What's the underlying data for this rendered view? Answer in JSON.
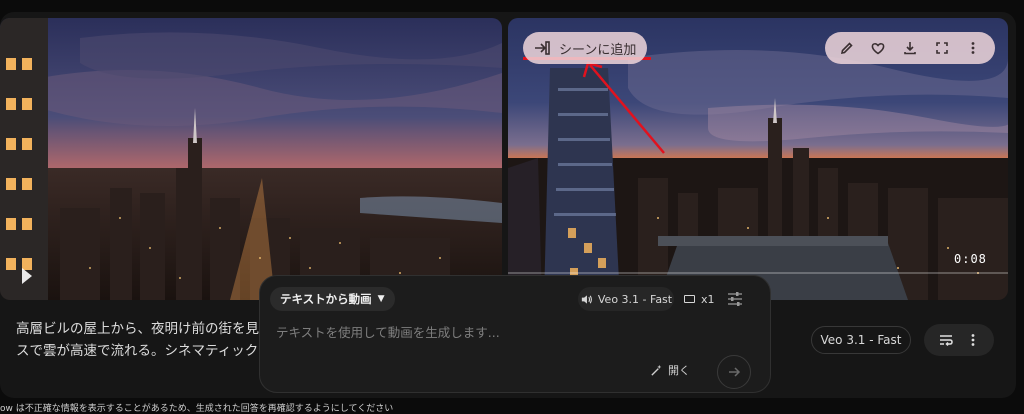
{
  "overlay": {
    "add_scene_label": "シーンに追加",
    "timestamp": "0:08"
  },
  "toolbar": {
    "icons": [
      "pencil-icon",
      "heart-icon",
      "download-icon",
      "fullscreen-icon",
      "more-vert-icon"
    ]
  },
  "description": {
    "line1": "高層ビルの屋上から、夜明け前の街を見下",
    "line2": "スで雲が高速で流れる。シネマティック"
  },
  "side_actions": {
    "model_label": "Veo 3.1 - Fast"
  },
  "composer": {
    "mode_label": "テキストから動画",
    "model_label": "Veo 3.1 - Fast",
    "count_label": "x1",
    "placeholder": "テキストを使用して動画を生成します...",
    "open_label": "開く"
  },
  "footer": {
    "disclaimer": "ow は不正確な情報を表示することがあるため、生成された回答を再確認するようにしてください"
  },
  "colors": {
    "annotation_red": "#e1121e",
    "pill_bg": "#eed6da",
    "sunset_orange": "#f07a3a",
    "night_blue": "#1f2b52"
  }
}
